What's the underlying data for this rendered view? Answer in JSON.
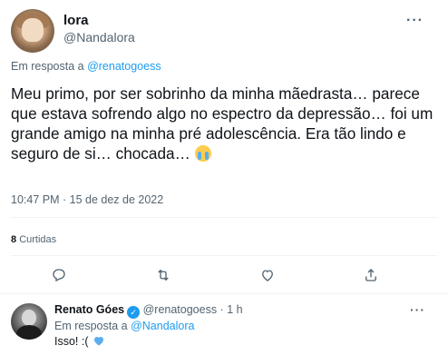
{
  "tweet": {
    "author_name": "lora",
    "author_handle": "@Nandalora",
    "more_label": "···",
    "reply_prefix": "Em resposta a",
    "reply_to": "@renatogoess",
    "text": "Meu primo, por ser sobrinho da minha mãedrasta… parece que estava sofrendo algo no espectro da depressão… foi um grande amigo na minha pré adolescência. Era tão lindo e seguro de si… chocada…",
    "emoji": "loudly-crying-face",
    "timestamp": "10:47 PM · 15 de dez de 2022",
    "retweet_count": "8",
    "retweet_label": "Curtidas"
  },
  "actions": [
    {
      "icon": "reply-icon"
    },
    {
      "icon": "retweet-icon"
    },
    {
      "icon": "like-icon"
    },
    {
      "icon": "share-icon"
    }
  ],
  "reply": {
    "author_name": "Renato Góes",
    "author_handle": "@renatogoess · 1 h",
    "verified": true,
    "more_label": "···",
    "reply_prefix": "Em resposta a",
    "reply_to": "@Nandalora",
    "text": "Isso! :(",
    "emoji": "blue-heart"
  },
  "colors": {
    "accent": "#1d9bf0",
    "text": "#0f1419",
    "secondary": "#536471",
    "divider": "#eff3f4"
  }
}
